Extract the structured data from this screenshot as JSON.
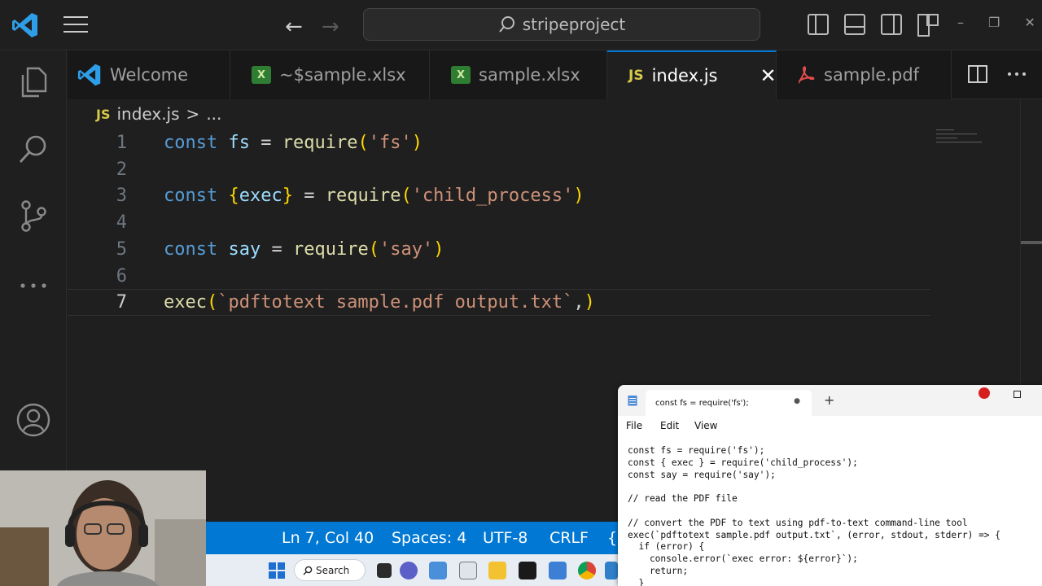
{
  "titlebar": {
    "search_text": "stripeproject",
    "back_label": "←",
    "forward_label": "→"
  },
  "activity_bar": {
    "items": [
      "explorer-icon",
      "search-icon",
      "source-control-icon",
      "more-icon",
      "account-icon"
    ]
  },
  "tabs": [
    {
      "label": "Welcome",
      "icon": "vscode-icon",
      "active": false
    },
    {
      "label": "~$sample.xlsx",
      "icon": "excel-icon",
      "active": false
    },
    {
      "label": "sample.xlsx",
      "icon": "excel-icon",
      "active": false
    },
    {
      "label": "index.js",
      "icon": "js-icon",
      "active": true,
      "close": "✕"
    },
    {
      "label": "sample.pdf",
      "icon": "pdf-icon",
      "active": false
    }
  ],
  "breadcrumb": {
    "badge": "JS",
    "file": "index.js",
    "sep": ">",
    "rest": "..."
  },
  "editor": {
    "lines": [
      {
        "num": "1",
        "code": "const fs = require('fs')"
      },
      {
        "num": "2",
        "code": ""
      },
      {
        "num": "3",
        "code": "const {exec} = require('child_process')"
      },
      {
        "num": "4",
        "code": ""
      },
      {
        "num": "5",
        "code": "const say = require('say')"
      },
      {
        "num": "6",
        "code": ""
      },
      {
        "num": "7",
        "code": "exec(`pdftotext sample.pdf output.txt`,)"
      }
    ],
    "current_line": 7
  },
  "statusbar": {
    "position": "Ln 7, Col 40",
    "spaces": "Spaces: 4",
    "encoding": "UTF-8",
    "eol": "CRLF",
    "lang_prefix": "{"
  },
  "taskbar": {
    "search_label": "Search"
  },
  "notepad": {
    "tab_title": "const fs = require('fs');",
    "tab_dot": "●",
    "new_tab": "+",
    "menu": [
      "File",
      "Edit",
      "View"
    ],
    "body": "const fs = require('fs');\nconst { exec } = require('child_process');\nconst say = require('say');\n\n// read the PDF file\n\n// convert the PDF to text using pdf-to-text command-line tool\nexec(`pdftotext sample.pdf output.txt`, (error, stdout, stderr) => {\n  if (error) {\n    console.error(`exec error: ${error}`);\n    return;\n  }"
  },
  "colors": {
    "accent": "#0078d4",
    "editor_bg": "#1f1f1f",
    "keyword": "#569cd6",
    "string": "#ce9178",
    "function": "#dcdcaa",
    "variable": "#9cdcfe"
  }
}
